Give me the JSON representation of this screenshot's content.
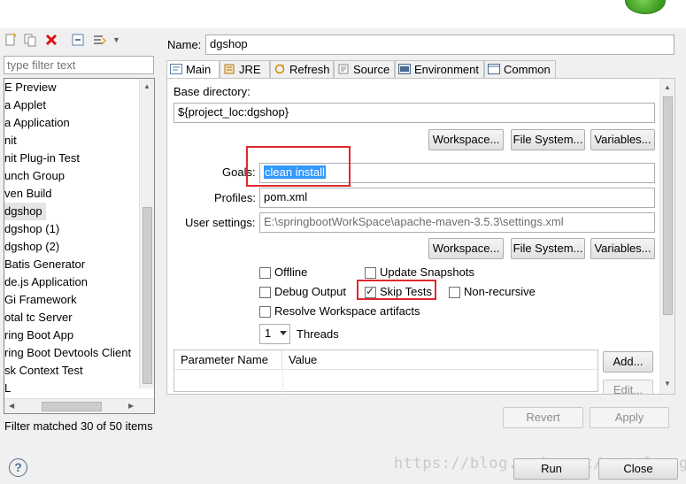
{
  "left_pane": {
    "filter_placeholder": "type filter text",
    "items": [
      {
        "label": "E Preview"
      },
      {
        "label": "a Applet"
      },
      {
        "label": "a Application"
      },
      {
        "label": "nit"
      },
      {
        "label": "nit Plug-in Test"
      },
      {
        "label": "unch Group"
      },
      {
        "label": "ven Build"
      },
      {
        "label": "dgshop",
        "selected": true
      },
      {
        "label": "dgshop (1)"
      },
      {
        "label": "dgshop (2)"
      },
      {
        "label": "Batis Generator"
      },
      {
        "label": "de.js Application"
      },
      {
        "label": "Gi Framework"
      },
      {
        "label": "otal tc Server"
      },
      {
        "label": "ring Boot App"
      },
      {
        "label": "ring Boot Devtools Client"
      },
      {
        "label": "sk Context Test"
      },
      {
        "label": "L"
      }
    ],
    "status": "Filter matched 30 of 50 items"
  },
  "name": {
    "label": "Name:",
    "value": "dgshop"
  },
  "tabs": [
    {
      "label": "Main",
      "icon": "main-tab-icon",
      "active": true
    },
    {
      "label": "JRE",
      "icon": "jre-icon"
    },
    {
      "label": "Refresh",
      "icon": "refresh-icon"
    },
    {
      "label": "Source",
      "icon": "source-icon"
    },
    {
      "label": "Environment",
      "icon": "environment-icon"
    },
    {
      "label": "Common",
      "icon": "common-icon"
    }
  ],
  "main": {
    "base_directory_label": "Base directory:",
    "base_directory_value": "${project_loc:dgshop}",
    "workspace_btn": "Workspace...",
    "filesystem_btn": "File System...",
    "variables_btn": "Variables...",
    "goals_label": "Goals:",
    "goals_value": "clean install",
    "profiles_label": "Profiles:",
    "profiles_value": "pom.xml",
    "user_settings_label": "User settings:",
    "user_settings_value": "E:\\springbootWorkSpace\\apache-maven-3.5.3\\settings.xml",
    "checks": {
      "offline": "Offline",
      "update_snapshots": "Update Snapshots",
      "debug_output": "Debug Output",
      "skip_tests": "Skip Tests",
      "non_recursive": "Non-recursive",
      "resolve_workspace": "Resolve Workspace artifacts"
    },
    "threads_value": "1",
    "threads_label": "Threads",
    "table_headers": [
      "Parameter Name",
      "Value"
    ],
    "add_btn": "Add...",
    "edit_btn": "Edit..."
  },
  "footer": {
    "revert": "Revert",
    "apply": "Apply",
    "run": "Run",
    "close": "Close",
    "watermark": "https://blog.csdn.net/yangfenngui"
  },
  "colors": {
    "highlight": "#3399ff",
    "annotation_red": "#e0282e"
  }
}
